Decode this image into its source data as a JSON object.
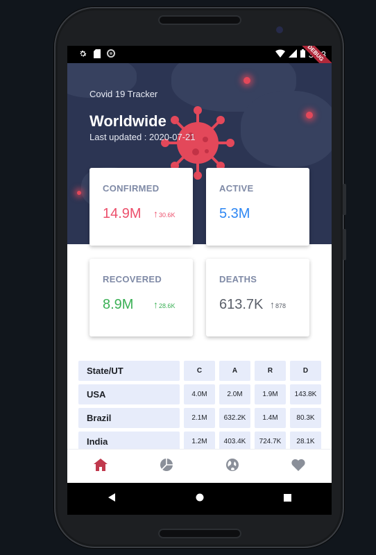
{
  "status_bar": {
    "time": "3:23",
    "debug_label": "DEBUG"
  },
  "header": {
    "app_title": "Covid 19 Tracker",
    "region": "Worldwide",
    "last_updated": "Last updated : 2020-07-21"
  },
  "cards": {
    "confirmed": {
      "label": "CONFIRMED",
      "value": "14.9M",
      "delta": "30.6K",
      "color": "#ec4f6b"
    },
    "active": {
      "label": "ACTIVE",
      "value": "5.3M",
      "color": "#2e87f3"
    },
    "recovered": {
      "label": "RECOVERED",
      "value": "8.9M",
      "delta": "28.6K",
      "color": "#3ab055"
    },
    "deaths": {
      "label": "DEATHS",
      "value": "613.7K",
      "delta": "878",
      "color": "#5a5f69"
    }
  },
  "table": {
    "headers": [
      "State/UT",
      "C",
      "A",
      "R",
      "D"
    ],
    "rows": [
      [
        "USA",
        "4.0M",
        "2.0M",
        "1.9M",
        "143.8K"
      ],
      [
        "Brazil",
        "2.1M",
        "632.2K",
        "1.4M",
        "80.3K"
      ],
      [
        "India",
        "1.2M",
        "403.4K",
        "724.7K",
        "28.1K"
      ]
    ]
  },
  "bottom_nav": [
    {
      "icon": "home-icon",
      "active": true
    },
    {
      "icon": "pie-chart-icon",
      "active": false
    },
    {
      "icon": "globe-icon",
      "active": false
    },
    {
      "icon": "heart-icon",
      "active": false
    }
  ],
  "colors": {
    "header_bg": "#2c3553",
    "accent_active": "#c0394d",
    "nav_inactive": "#8a8f99",
    "table_cell_bg": "#e7ecfa"
  }
}
